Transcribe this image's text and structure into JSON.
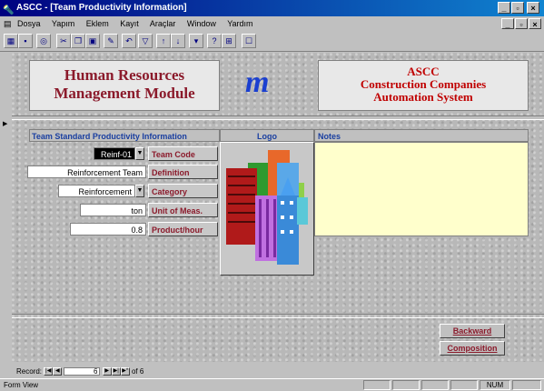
{
  "window": {
    "title": "ASCC - [Team Productivity Information]"
  },
  "menu": [
    "Dosya",
    "Yapım",
    "Eklem",
    "Kayıt",
    "Araçlar",
    "Window",
    "Yardım"
  ],
  "header": {
    "left_title_line1": "Human Resources",
    "left_title_line2": "Management Module",
    "logo_letter": "m",
    "right_title_line1": "ASCC",
    "right_title_line2": "Construction Companies",
    "right_title_line3": "Automation System"
  },
  "columns": {
    "info": "Team Standard Productivity Information",
    "logo": "Logo",
    "notes": "Notes"
  },
  "fields": {
    "team_code": {
      "label": "Team Code",
      "value": "Reinf-01"
    },
    "definition": {
      "label": "Definition",
      "value": "Reinforcement Team"
    },
    "category": {
      "label": "Category",
      "value": "Reinforcement"
    },
    "unit": {
      "label": "Unit of Meas.",
      "value": "ton"
    },
    "product_hour": {
      "label": "Product/hour",
      "value": "0.8"
    }
  },
  "notes_text": "",
  "buttons": {
    "backward": "Backward",
    "composition": "Composition"
  },
  "record_nav": {
    "label": "Record:",
    "current": "6",
    "of_label": "of 6"
  },
  "status": {
    "mode": "Form View",
    "num": "NUM"
  },
  "colors": {
    "accent_red": "#8b1a2b",
    "title_blue": "#000080",
    "notes_bg": "#ffffcc"
  }
}
